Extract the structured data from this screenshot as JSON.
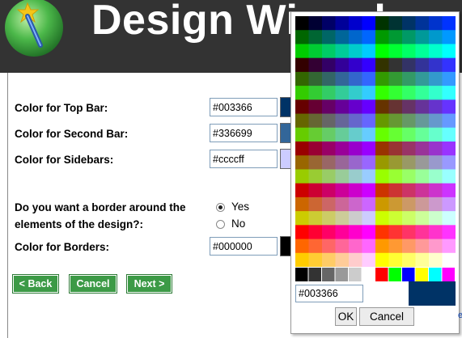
{
  "header": {
    "title": "Design Wizard",
    "background": "#333333",
    "logo_icon": "wand-icon"
  },
  "form": {
    "top_bar": {
      "label": "Color for Top Bar:",
      "value": "#003366",
      "swatch": "#003366"
    },
    "second_bar": {
      "label": "Color for Second Bar:",
      "value": "#336699",
      "swatch": "#336699"
    },
    "sidebars": {
      "label": "Color for Sidebars:",
      "value": "#ccccff",
      "swatch": "#ccccff"
    },
    "border_question": {
      "line1": "Do you want a border around the",
      "line2": "elements of the design?:"
    },
    "border_options": {
      "yes": "Yes",
      "no": "No",
      "selected": "yes"
    },
    "borders": {
      "label": "Color for Borders:",
      "value": "#000000",
      "swatch": "#000000"
    }
  },
  "nav": {
    "back_label": "< Back",
    "cancel_label": "Cancel",
    "next_label": "Next >",
    "button_color": "#3c9a46"
  },
  "color_picker": {
    "hex_value": "#003366",
    "preview_color": "#003366",
    "ok_label": "OK",
    "cancel_label": "Cancel",
    "gray_swatches": [
      "#000000",
      "#333333",
      "#666666",
      "#999999",
      "#cccccc",
      "#ffffff"
    ],
    "bright_swatches": [
      "#ff0000",
      "#00ff00",
      "#0000ff",
      "#ffff00",
      "#00ffff",
      "#ff00ff"
    ],
    "edge_glyph": "e"
  }
}
